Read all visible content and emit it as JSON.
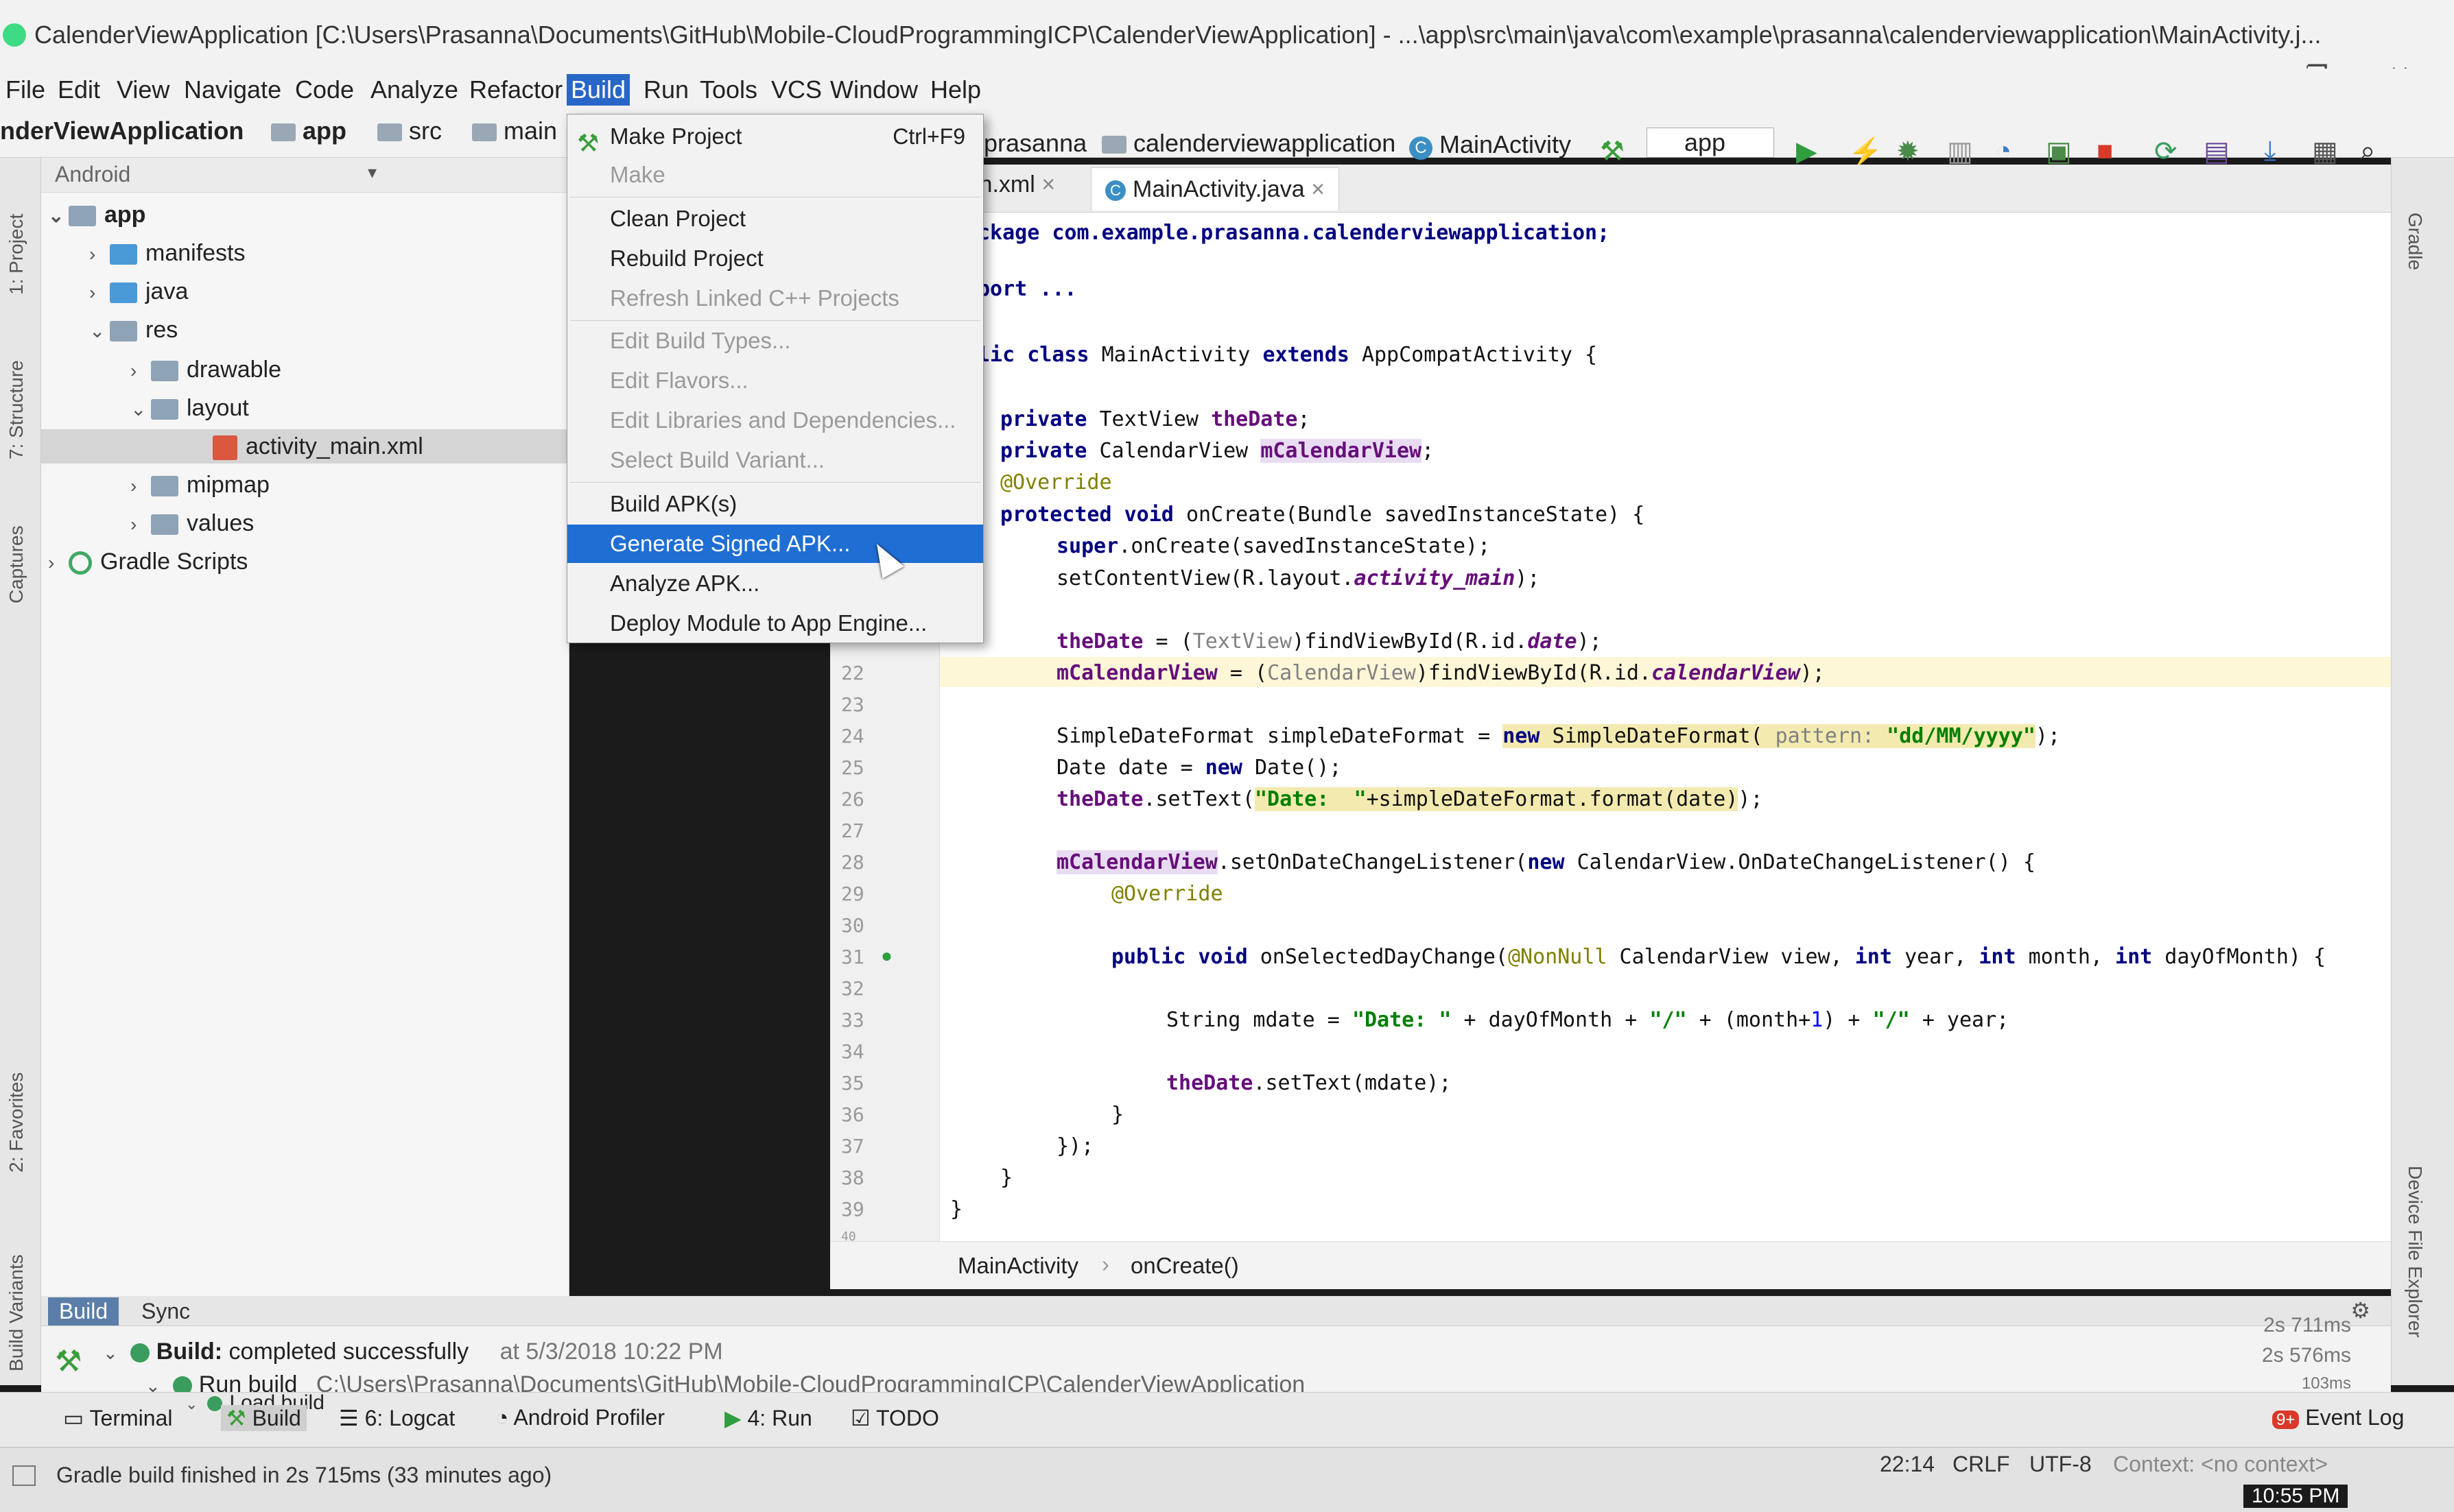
{
  "window": {
    "title": "CalenderViewApplication [C:\\Users\\Prasanna\\Documents\\GitHub\\Mobile-CloudProgrammingICP\\CalenderViewApplication] - ...\\app\\src\\main\\java\\com\\example\\prasanna\\calenderviewapplication\\MainActivity.j...",
    "minimize": "–",
    "restore": "❐",
    "close": "✕"
  },
  "menubar": [
    "File",
    "Edit",
    "View",
    "Navigate",
    "Code",
    "Analyze",
    "Refactor",
    "Build",
    "Run",
    "Tools",
    "VCS",
    "Window",
    "Help"
  ],
  "navbar": {
    "crumbs": [
      "nderViewApplication",
      "app",
      "src",
      "main"
    ],
    "right_crumbs": [
      "prasanna",
      "calenderviewapplication",
      "MainActivity"
    ],
    "run_config": "app"
  },
  "left_tabs": [
    "1: Project",
    "7: Structure",
    "Captures",
    "2: Favorites",
    "Build Variants"
  ],
  "right_tabs": [
    "Gradle",
    "Device File Explorer"
  ],
  "project_panel": {
    "view_selector": "Android",
    "tree": [
      "app",
      "manifests",
      "java",
      "res",
      "drawable",
      "layout",
      "activity_main.xml",
      "mipmap",
      "values",
      "Gradle Scripts"
    ]
  },
  "build_menu": {
    "items": [
      {
        "label": "Make Project",
        "shortcut": "Ctrl+F9",
        "enabled": true
      },
      {
        "label": "Make",
        "shortcut": "",
        "enabled": false
      },
      {
        "label": "Clean Project",
        "shortcut": "",
        "enabled": true
      },
      {
        "label": "Rebuild Project",
        "shortcut": "",
        "enabled": true
      },
      {
        "label": "Refresh Linked C++ Projects",
        "shortcut": "",
        "enabled": false
      },
      {
        "label": "Edit Build Types...",
        "shortcut": "",
        "enabled": false
      },
      {
        "label": "Edit Flavors...",
        "shortcut": "",
        "enabled": false
      },
      {
        "label": "Edit Libraries and Dependencies...",
        "shortcut": "",
        "enabled": false
      },
      {
        "label": "Select Build Variant...",
        "shortcut": "",
        "enabled": false
      },
      {
        "label": "Build APK(s)",
        "shortcut": "",
        "enabled": true
      },
      {
        "label": "Generate Signed APK...",
        "shortcut": "",
        "enabled": true,
        "selected": true
      },
      {
        "label": "Analyze APK...",
        "shortcut": "",
        "enabled": true
      },
      {
        "label": "Deploy Module to App Engine...",
        "shortcut": "",
        "enabled": true
      }
    ]
  },
  "editor": {
    "tabs": [
      "in.xml",
      "MainActivity.java"
    ],
    "line_numbers": [
      "22",
      "23",
      "24",
      "25",
      "26",
      "27",
      "28",
      "29",
      "30",
      "31",
      "32",
      "33",
      "34",
      "35",
      "36",
      "37",
      "38",
      "39",
      "40"
    ],
    "code": {
      "l_package": "ckage com.example.prasanna.calenderviewapplication;",
      "l_import": "port ...",
      "l_class_a": "lic class ",
      "l_class_b": "MainActivity ",
      "l_class_c": "extends ",
      "l_class_d": "AppCompatActivity {",
      "l_f1_a": "private ",
      "l_f1_b": "TextView ",
      "l_f1_c": "theDate",
      "l_f1_d": ";",
      "l_f2_a": "private ",
      "l_f2_b": "CalendarView ",
      "l_f2_c": "mCalendarView",
      "l_f2_d": ";",
      "l_override": "@Override",
      "l_oncreate_a": "protected void ",
      "l_oncreate_b": "onCreate(Bundle savedInstanceState) {",
      "l_super_a": "super",
      "l_super_b": ".onCreate(savedInstanceState);",
      "l_setcv_a": "setContentView(R.layout.",
      "l_setcv_b": "activity_main",
      "l_setcv_c": ");",
      "l_thedate_a": "theDate",
      "l_thedate_b": " = (",
      "l_thedate_c": "TextView",
      "l_thedate_d": ")findViewById(R.id.",
      "l_thedate_e": "date",
      "l_thedate_f": ");",
      "l_mcal_a": "mCalendarView",
      "l_mcal_b": " = (",
      "l_mcal_c": "CalendarView",
      "l_mcal_d": ")findViewById(R.id.",
      "l_mcal_e": "calendarView",
      "l_mcal_f": ");",
      "l_sdf_a": "SimpleDateFormat simpleDateFormat = ",
      "l_sdf_b": "new ",
      "l_sdf_c": "SimpleDateFormat( ",
      "l_sdf_d": "pattern: ",
      "l_sdf_e": "\"dd/MM/yyyy\"",
      "l_sdf_f": ");",
      "l_date_a": "Date date = ",
      "l_date_b": "new ",
      "l_date_c": "Date();",
      "l_settext_a": "theDate",
      "l_settext_b": ".setText(",
      "l_settext_c": "\"Date:  \"",
      "l_settext_d": "+simpleDateFormat.format(date)",
      "l_settext_e": ");",
      "l_listener_a": "mCalendarView",
      "l_listener_b": ".setOnDateChangeListener(",
      "l_listener_c": "new ",
      "l_listener_d": "CalendarView.OnDateChangeListener() {",
      "l_override2": "@Override",
      "l_sel_a": "public void ",
      "l_sel_b": "onSelectedDayChange(",
      "l_sel_c": "@NonNull ",
      "l_sel_d": "CalendarView view, ",
      "l_sel_e": "int ",
      "l_sel_f": "year, ",
      "l_sel_g": "int ",
      "l_sel_h": "month, ",
      "l_sel_i": "int ",
      "l_sel_j": "dayOfMonth) {",
      "l_mdate_a": "String mdate = ",
      "l_mdate_b": "\"Date: \"",
      "l_mdate_c": " + dayOfMonth + ",
      "l_mdate_d": "\"/\"",
      "l_mdate_e": " + (month+",
      "l_mdate_f": "1",
      "l_mdate_g": ") + ",
      "l_mdate_h": "\"/\"",
      "l_mdate_i": " + year;",
      "l_settext2_a": "theDate",
      "l_settext2_b": ".setText(mdate);",
      "l_close1": "}",
      "l_close2": "});",
      "l_close3": "}",
      "l_close4": "}"
    },
    "breadcrumb": [
      "MainActivity",
      "onCreate()"
    ]
  },
  "build_panel": {
    "tabs": [
      "Build",
      "Sync"
    ],
    "row1_bold": "Build:",
    "row1_text": " completed successfully",
    "row1_time": "at 5/3/2018 10:22 PM",
    "row2_label": "Run build",
    "row2_path": "C:\\Users\\Prasanna\\Documents\\GitHub\\Mobile-CloudProgrammingICP\\CalenderViewApplication",
    "row3_label": "Load build",
    "timings": [
      "2s 711ms",
      "2s 576ms",
      "103ms"
    ]
  },
  "bottom_tools": [
    "Terminal",
    "Build",
    "6: Logcat",
    "Android Profiler",
    "4: Run",
    "TODO"
  ],
  "event_log": {
    "badge": "9+",
    "label": "Event Log"
  },
  "status": {
    "message": "Gradle build finished in 2s 715ms (33 minutes ago)",
    "position": "22:14",
    "line_sep": "CRLF",
    "encoding": "UTF-8",
    "context": "Context: <no context>",
    "clock": "10:55 PM"
  },
  "colors": {
    "menu_selected": "#1f6ed4",
    "active_menu": "#2866c8",
    "editor_bg": "#ffffff"
  }
}
